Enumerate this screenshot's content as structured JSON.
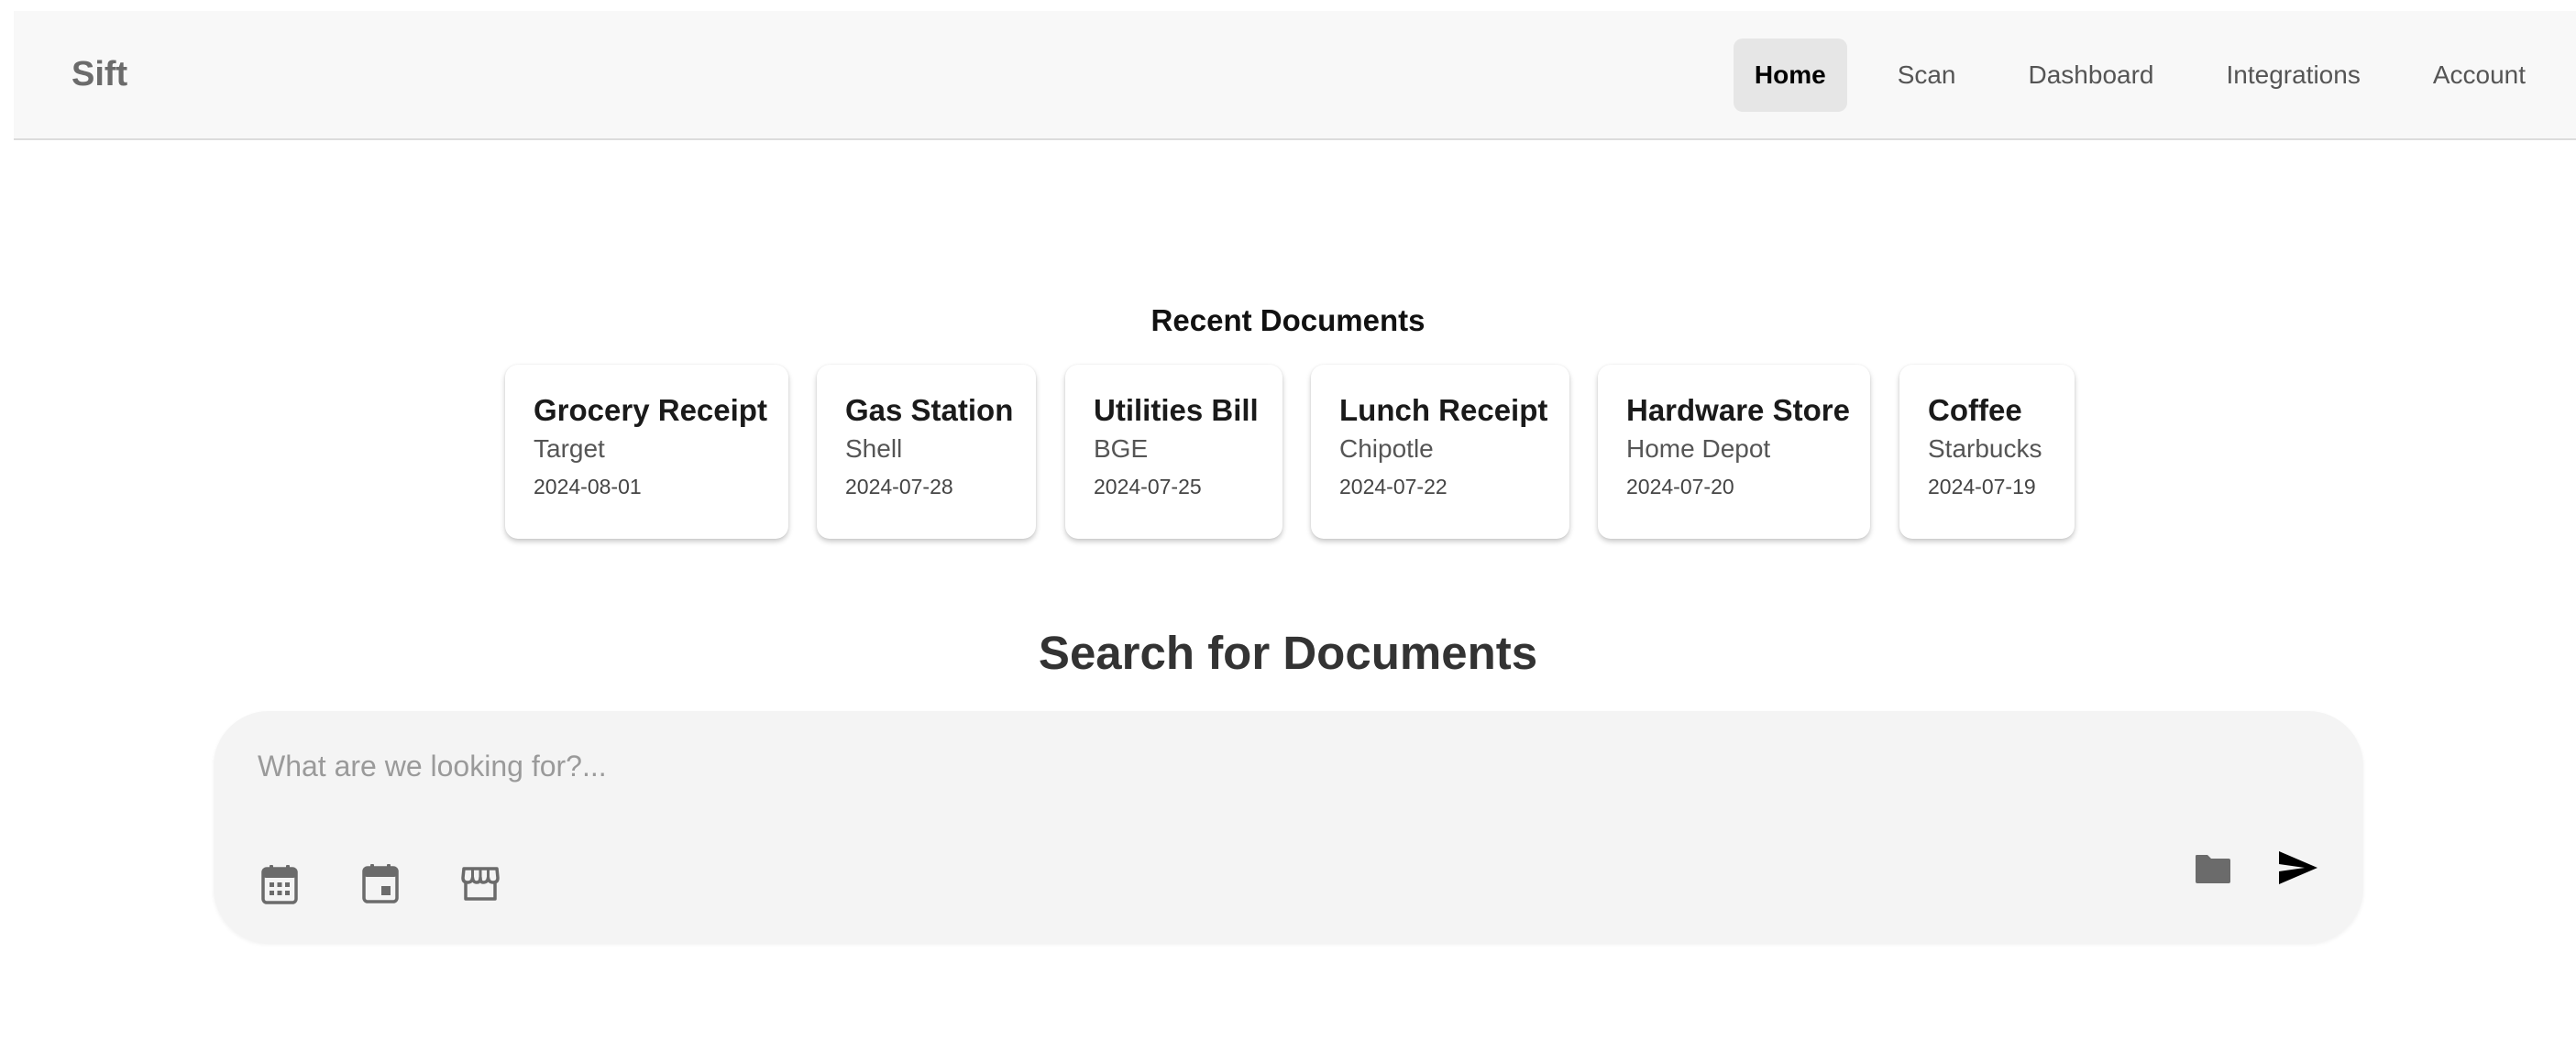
{
  "brand": "Sift",
  "nav": {
    "items": [
      {
        "label": "Home",
        "active": true
      },
      {
        "label": "Scan",
        "active": false
      },
      {
        "label": "Dashboard",
        "active": false
      },
      {
        "label": "Integrations",
        "active": false
      },
      {
        "label": "Account",
        "active": false
      }
    ]
  },
  "recent": {
    "title": "Recent Documents",
    "cards": [
      {
        "title": "Grocery Receipt",
        "merchant": "Target",
        "date": "2024-08-01"
      },
      {
        "title": "Gas Station",
        "merchant": "Shell",
        "date": "2024-07-28"
      },
      {
        "title": "Utilities Bill",
        "merchant": "BGE",
        "date": "2024-07-25"
      },
      {
        "title": "Lunch Receipt",
        "merchant": "Chipotle",
        "date": "2024-07-22"
      },
      {
        "title": "Hardware Store",
        "merchant": "Home Depot",
        "date": "2024-07-20"
      },
      {
        "title": "Coffee",
        "merchant": "Starbucks",
        "date": "2024-07-19"
      }
    ]
  },
  "search": {
    "title": "Search for Documents",
    "placeholder": "What are we looking for?...",
    "value": "",
    "tools_left": [
      "calendar-range-icon",
      "calendar-event-icon",
      "store-icon"
    ],
    "tools_right": [
      "folder-icon",
      "send-icon"
    ]
  },
  "colors": {
    "nav_background": "#f8f8f8",
    "active_tab_background": "#e6e6e6",
    "search_background": "#f4f4f4",
    "icon_gray": "#6b6b6b",
    "send_icon": "#000000"
  }
}
